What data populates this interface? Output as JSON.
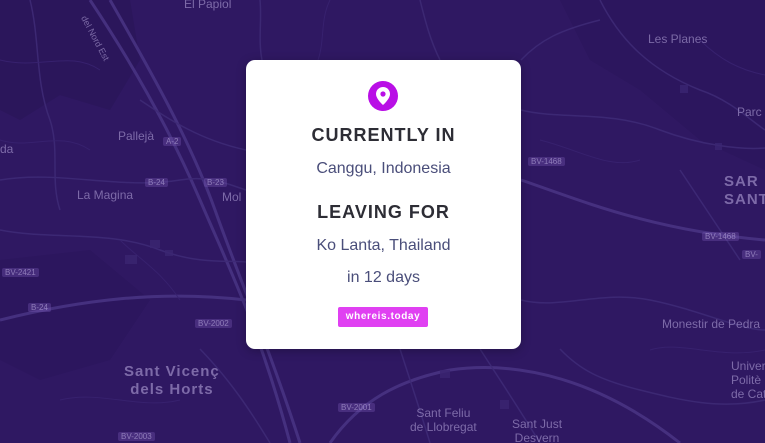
{
  "map": {
    "places": {
      "el_papiol": "El Papiol",
      "les_planes": "Les Planes",
      "parc": "Parc",
      "palleja": "Pallejà",
      "da": "da",
      "la_magina": "La Magina",
      "mol": "Mol",
      "sant_gervasi": "SAR\nSANT G",
      "sant_vicenc": "Sant Vicenç\ndels Horts",
      "monestir": "Monestir de Pedra",
      "sant_feliu": "Sant Feliu\nde Llobregat",
      "sant_just": "Sant Just\nDesvern",
      "universitat": "Univer\nPolitè\nde Cata",
      "road_nord": "del Nord Est"
    },
    "road_tags": [
      "B-24",
      "B-23",
      "BV-1468",
      "BV-1468",
      "BV-2002",
      "BV-2001",
      "BV-2003",
      "B-24",
      "A-2",
      "BV-2421",
      "BV-"
    ]
  },
  "card": {
    "pin_icon": "map-pin-icon",
    "currently_heading": "CURRENTLY IN",
    "current_location": "Canggu, Indonesia",
    "leaving_heading": "LEAVING FOR",
    "next_location": "Ko Lanta, Thailand",
    "countdown": "in 12 days",
    "badge_label": "whereis.today"
  },
  "colors": {
    "map_background": "#2f1862",
    "pin": "#b90fe6",
    "badge": "#e040f2"
  }
}
